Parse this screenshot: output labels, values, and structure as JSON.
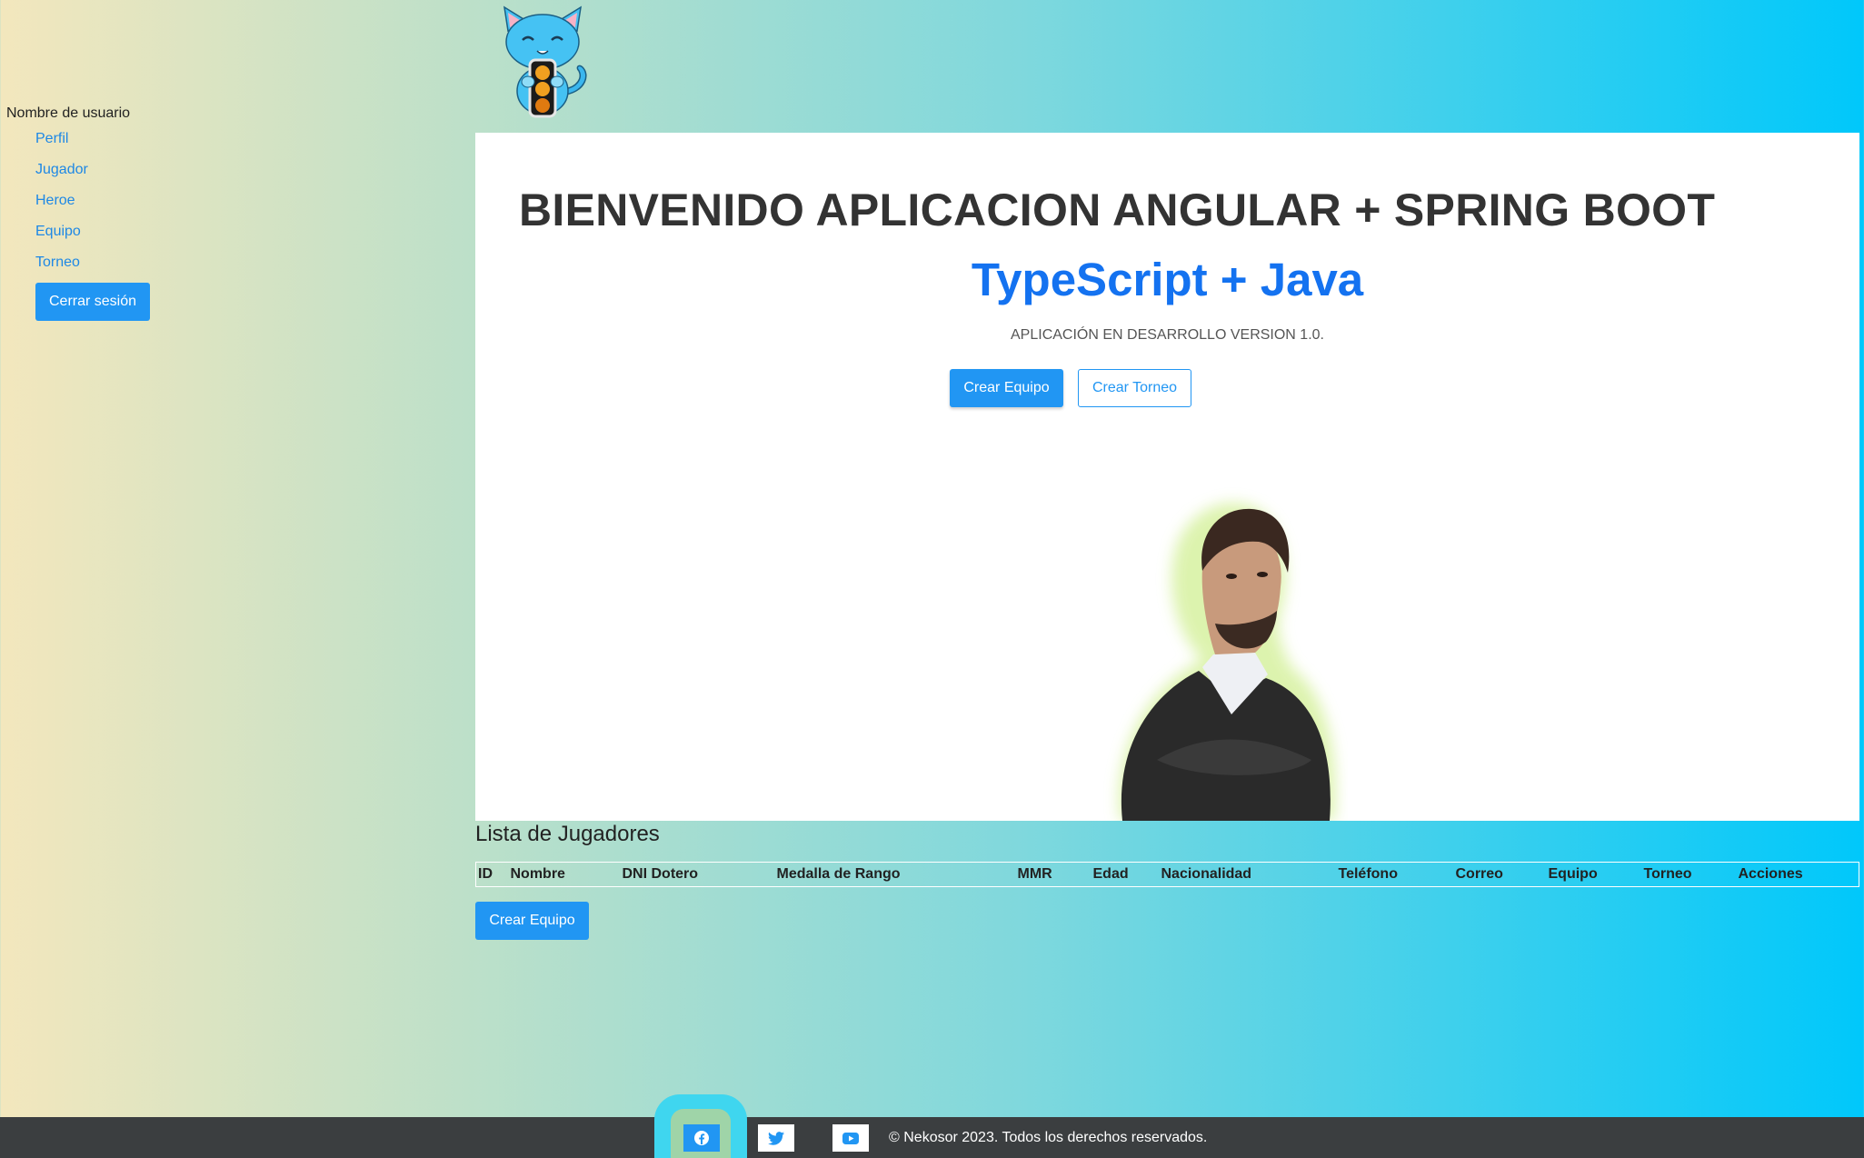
{
  "sidebar": {
    "username": "Nombre de usuario",
    "items": [
      {
        "label": "Perfil"
      },
      {
        "label": "Jugador"
      },
      {
        "label": "Heroe"
      },
      {
        "label": "Equipo"
      },
      {
        "label": "Torneo"
      }
    ],
    "logout_label": "Cerrar sesión"
  },
  "logo": {
    "icon": "cat-traffic-light-logo"
  },
  "hero": {
    "title": "BIENVENIDO APLICACION ANGULAR + SPRING BOOT",
    "subtitle": "TypeScript + Java",
    "version": "APLICACIÓN EN DESARROLLO VERSION 1.0.",
    "primary_button": "Crear Equipo",
    "secondary_button": "Crear Torneo"
  },
  "players": {
    "title": "Lista de Jugadores",
    "columns": [
      "ID",
      "Nombre",
      "DNI Dotero",
      "Medalla de Rango",
      "MMR",
      "Edad",
      "Nacionalidad",
      "Teléfono",
      "Correo",
      "Equipo",
      "Torneo",
      "Acciones"
    ],
    "create_button": "Crear Equipo"
  },
  "footer": {
    "social": [
      {
        "icon": "facebook-icon"
      },
      {
        "icon": "twitter-icon"
      },
      {
        "icon": "youtube-icon"
      }
    ],
    "copyright": "© Nekosor 2023. Todos los derechos reservados."
  },
  "colors": {
    "accent": "#2196f3",
    "subtitle": "#1472f0",
    "footer_bg": "#3b3e40"
  }
}
